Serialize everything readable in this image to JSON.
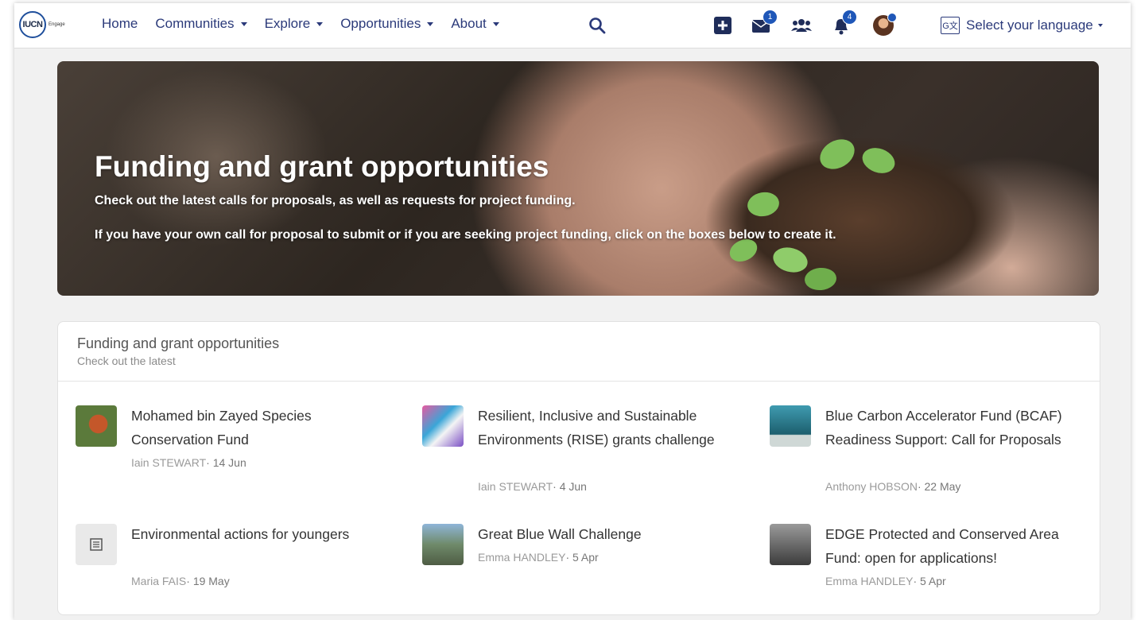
{
  "nav": {
    "logo_text": "IUCN",
    "logo_sub": "Engage",
    "items": [
      {
        "label": "Home",
        "dropdown": false
      },
      {
        "label": "Communities",
        "dropdown": true
      },
      {
        "label": "Explore",
        "dropdown": true
      },
      {
        "label": "Opportunities",
        "dropdown": true
      },
      {
        "label": "About",
        "dropdown": true
      }
    ],
    "messages_badge": "1",
    "notifications_badge": "4",
    "language_label": "Select your language"
  },
  "hero": {
    "title": "Funding and grant opportunities",
    "line1": "Check out the latest calls for proposals, as well as requests for project funding.",
    "line2": "If you have your own call for proposal to submit or if you are seeking project funding, click on the boxes below to create it."
  },
  "card": {
    "title": "Funding and grant opportunities",
    "subtitle": "Check out the latest",
    "items": [
      {
        "title": "Mohamed bin Zayed Species Conservation Fund",
        "author": "Iain STEWART",
        "date": "14 Jun",
        "thumb": "red-panda"
      },
      {
        "title": "Resilient, Inclusive and Sustainable Environments (RISE) grants challenge",
        "author": "Iain STEWART",
        "date": "4 Jun",
        "thumb": "rise-graphic"
      },
      {
        "title": "Blue Carbon Accelerator Fund (BCAF) Readiness Support: Call for Proposals",
        "author": "Anthony HOBSON",
        "date": "22 May",
        "thumb": "ocean"
      },
      {
        "title": "Environmental actions for youngers",
        "author": "Maria FAIS",
        "date": "19 May",
        "thumb": "document-icon"
      },
      {
        "title": "Great Blue Wall Challenge",
        "author": "Emma HANDLEY",
        "date": "5 Apr",
        "thumb": "coast"
      },
      {
        "title": "EDGE Protected and Conserved Area Fund: open for applications!",
        "author": "Emma HANDLEY",
        "date": "5 Apr",
        "thumb": "edge-landscape"
      }
    ]
  },
  "colors": {
    "nav_text": "#2b3a7a",
    "badge": "#1f57b8"
  }
}
